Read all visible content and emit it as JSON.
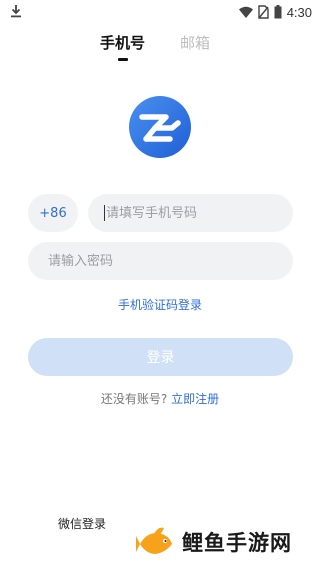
{
  "status_bar": {
    "time": "4:30"
  },
  "tabs": [
    {
      "label": "手机号",
      "active": true
    },
    {
      "label": "邮箱",
      "active": false
    }
  ],
  "form": {
    "country_code": "+86",
    "phone_placeholder": "请填写手机号码",
    "password_placeholder": "请输入密码",
    "sms_login_label": "手机验证码登录",
    "login_button": "登录",
    "register_prompt": "还没有账号?",
    "register_link": "立即注册"
  },
  "footer": {
    "wechat_login": "微信登录",
    "watermark_text": "鲤鱼手游网"
  },
  "colors": {
    "accent": "#2f6fd8",
    "button_disabled": "#cfe0f7",
    "field_bg": "#f1f2f4",
    "watermark_fish": "#f7a21b"
  }
}
